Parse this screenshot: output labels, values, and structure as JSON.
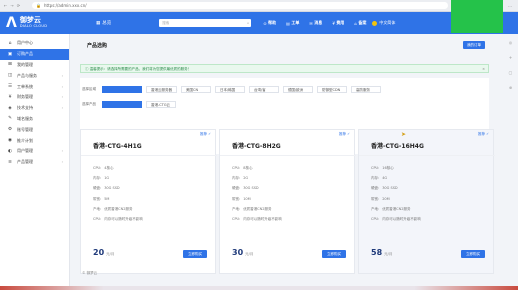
{
  "browser": {
    "url": "https://admin.xxx.cn/",
    "nav_icons": [
      "←",
      "→",
      "⟳"
    ],
    "tools": [
      "☆",
      "⊕",
      "⚙",
      "…"
    ]
  },
  "header": {
    "logo_mark": "Λ",
    "logo_cn": "御梦云",
    "logo_en": "DIALO CLOUD",
    "home_label": "总览",
    "search_placeholder": "搜索",
    "search_icon": "⌕",
    "nav": [
      {
        "icon": "⊙",
        "label": "帮助"
      },
      {
        "icon": "▤",
        "label": "工单"
      },
      {
        "icon": "✉",
        "label": "消息"
      },
      {
        "icon": "¥",
        "label": "费用"
      },
      {
        "icon": "⌂",
        "label": "备案"
      }
    ],
    "user": "中文简体"
  },
  "sidebar": {
    "items": [
      {
        "icon": "⌂",
        "label": "用户中心",
        "active": false,
        "chevron": ""
      },
      {
        "icon": "▣",
        "label": "订购产品",
        "active": true,
        "chevron": ""
      },
      {
        "icon": "⊞",
        "label": "我的管理",
        "active": false,
        "chevron": ""
      },
      {
        "icon": "◫",
        "label": "产品与服务",
        "active": false,
        "chevron": "›"
      },
      {
        "icon": "☰",
        "label": "工单系统",
        "active": false,
        "chevron": "›"
      },
      {
        "icon": "¥",
        "label": "财务管理",
        "active": false,
        "chevron": "›"
      },
      {
        "icon": "◈",
        "label": "技术支持",
        "active": false,
        "chevron": "›"
      },
      {
        "icon": "✎",
        "label": "域名服务",
        "active": false,
        "chevron": ""
      },
      {
        "icon": "⚙",
        "label": "账号管理",
        "active": false,
        "chevron": ""
      },
      {
        "icon": "◉",
        "label": "推介计划",
        "active": false,
        "chevron": ""
      },
      {
        "icon": "◐",
        "label": "用户管理",
        "active": false,
        "chevron": "›"
      },
      {
        "icon": "≡",
        "label": "产品管理",
        "active": false,
        "chevron": "›"
      }
    ]
  },
  "main": {
    "title": "产品选购",
    "title_button": "我的订单",
    "alert": "温馨提示：请选择所需要的产品，我们将为您提供最优质的服务！",
    "alert_close": "×",
    "filter": {
      "row1_label": "选择区域",
      "row1_chips": [
        "",
        "香港云服务器",
        "美国CN",
        "日本/韩国",
        "台湾/省",
        "德国/欧洲",
        "防御型CDN",
        "高防服务"
      ],
      "row2_label": "选择产品",
      "row2_chips": [
        "",
        "香港-CTG云"
      ]
    },
    "section_label": "产品规格",
    "cards": [
      {
        "badge": "推荐 ✓",
        "name": "香港-CTG-4H1G",
        "specs": [
          {
            "k": "CPU:",
            "v": "4核心"
          },
          {
            "k": "内存:",
            "v": "1G"
          },
          {
            "k": "硬盘:",
            "v": "30G SSD"
          },
          {
            "k": "带宽:",
            "v": "5M"
          },
          {
            "k": "产地:",
            "v": "优质香港CN2服务"
          },
          {
            "k": "CPU:",
            "v": "内存可以随时升级不影响"
          }
        ],
        "price": "20",
        "unit": "元/月",
        "buy": "立即购买"
      },
      {
        "badge": "推荐 ✓",
        "name": "香港-CTG-8H2G",
        "specs": [
          {
            "k": "CPU:",
            "v": "8核心"
          },
          {
            "k": "内存:",
            "v": "2G"
          },
          {
            "k": "硬盘:",
            "v": "30G SSD"
          },
          {
            "k": "带宽:",
            "v": "10M"
          },
          {
            "k": "产地:",
            "v": "优质香港CN2服务"
          },
          {
            "k": "CPU:",
            "v": "内存可以随时升级不影响"
          }
        ],
        "price": "30",
        "unit": "元/月",
        "buy": "立即购买"
      },
      {
        "badge": "推荐 ✓",
        "name": "香港-CTG-16H4G",
        "specs": [
          {
            "k": "CPU:",
            "v": "16核心"
          },
          {
            "k": "内存:",
            "v": "4G"
          },
          {
            "k": "硬盘:",
            "v": "30G SSD"
          },
          {
            "k": "带宽:",
            "v": "20M"
          },
          {
            "k": "产地:",
            "v": "优质香港CN2服务"
          },
          {
            "k": "CPU:",
            "v": "内存可以随时升级不影响"
          }
        ],
        "price": "58",
        "unit": "元/月",
        "buy": "立即购买"
      }
    ],
    "footer": "© 御梦云"
  },
  "right_tools": [
    "◎",
    "+",
    "▢",
    "⊕"
  ],
  "colors": {
    "primary": "#2f73e7",
    "green_overlay": "#25c24a"
  }
}
